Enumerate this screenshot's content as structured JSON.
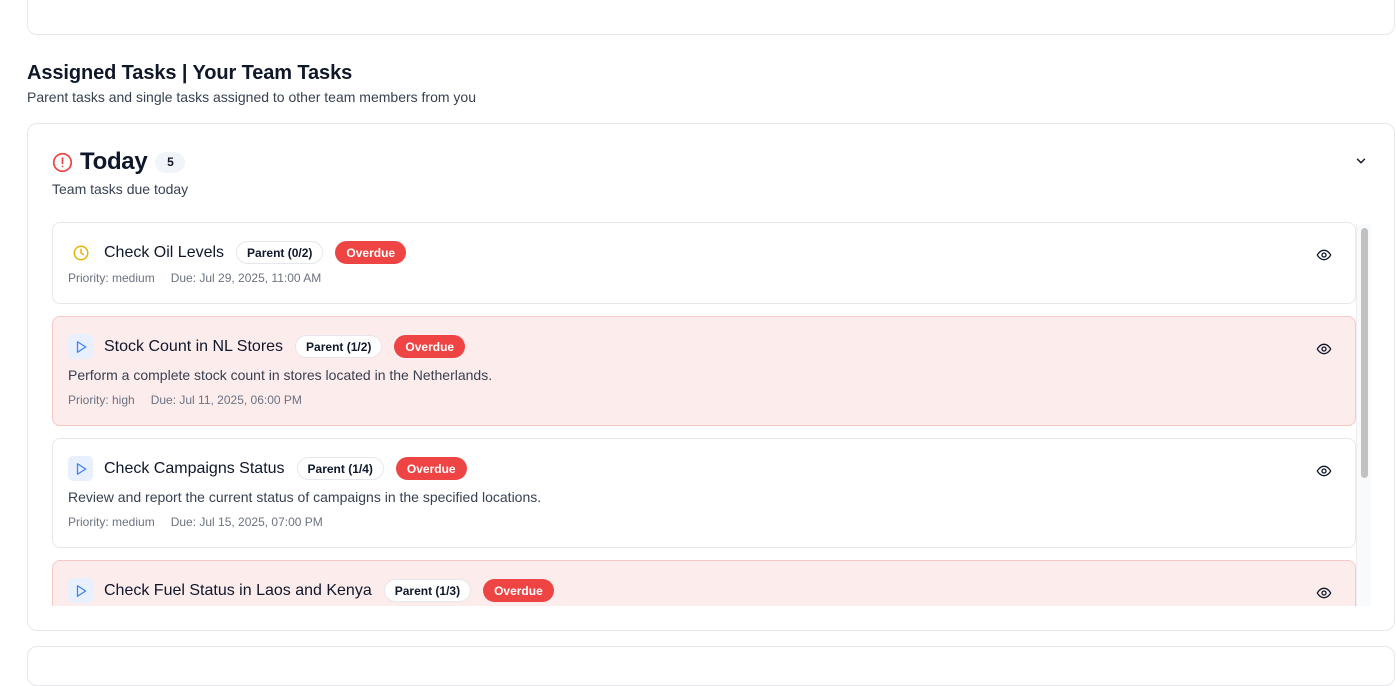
{
  "section": {
    "title": "Assigned Tasks | Your Team Tasks",
    "subtitle": "Parent tasks and single tasks assigned to other team members from you"
  },
  "group": {
    "icon": "alert-circle-icon",
    "title": "Today",
    "count": "5",
    "subtitle": "Team tasks due today",
    "toggle_icon": "chevron-down-icon"
  },
  "colors": {
    "overdue": "#ef4444",
    "overdue_card_bg": "#fdecec",
    "alert_icon": "#ef4444",
    "clock_icon": "#eab308",
    "play_icon": "#3b82f6"
  },
  "tasks": [
    {
      "icon": "clock-icon",
      "title": "Check Oil Levels",
      "parent": "Parent (0/2)",
      "status": "Overdue",
      "description": "",
      "priority": "Priority: medium",
      "due": "Due: Jul 29, 2025, 11:00 AM"
    },
    {
      "icon": "play-icon",
      "title": "Stock Count in NL Stores",
      "parent": "Parent (1/2)",
      "status": "Overdue",
      "description": "Perform a complete stock count in stores located in the Netherlands.",
      "priority": "Priority: high",
      "due": "Due: Jul 11, 2025, 06:00 PM"
    },
    {
      "icon": "play-icon",
      "title": "Check Campaigns Status",
      "parent": "Parent (1/4)",
      "status": "Overdue",
      "description": "Review and report the current status of campaigns in the specified locations.",
      "priority": "Priority: medium",
      "due": "Due: Jul 15, 2025, 07:00 PM"
    },
    {
      "icon": "play-icon",
      "title": "Check Fuel Status in Laos and Kenya",
      "parent": "Parent (1/3)",
      "status": "Overdue",
      "description": "",
      "priority": "",
      "due": ""
    }
  ],
  "view_icon": "eye-icon"
}
